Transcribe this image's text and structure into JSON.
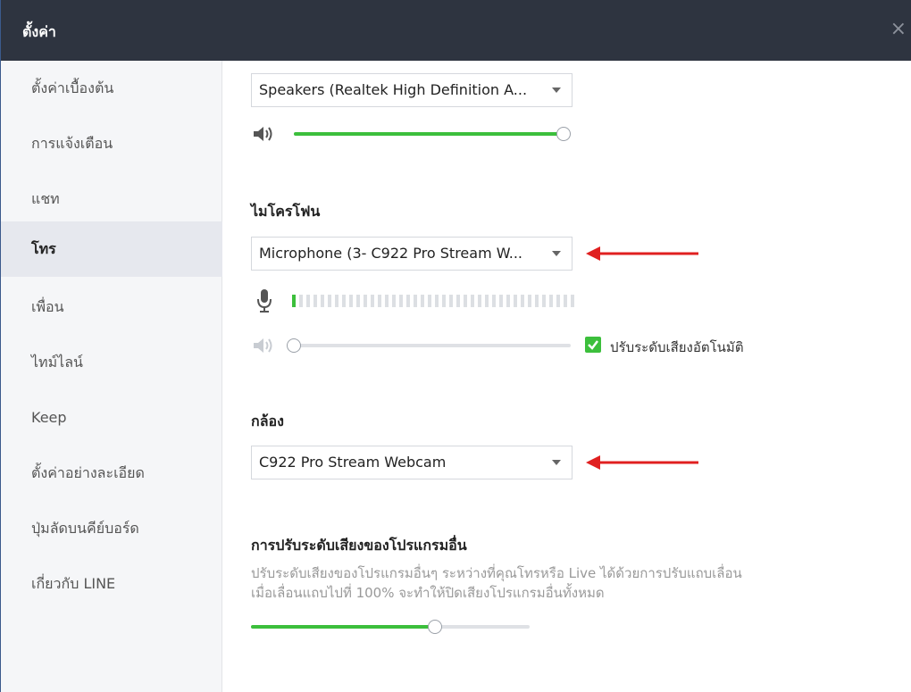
{
  "window": {
    "title": "ตั้งค่า",
    "close_glyph": "×"
  },
  "sidebar": {
    "items": [
      {
        "label": "ตั้งค่าเบื้องต้น"
      },
      {
        "label": "การแจ้งเตือน"
      },
      {
        "label": "แชท"
      },
      {
        "label": "โทร",
        "active": true
      },
      {
        "label": "เพื่อน"
      },
      {
        "label": "ไทม์ไลน์"
      },
      {
        "label": "Keep"
      },
      {
        "label": "ตั้งค่าอย่างละเอียด"
      },
      {
        "label": "ปุ่มลัดบนคีย์บอร์ด"
      },
      {
        "label": "เกี่ยวกับ LINE"
      }
    ]
  },
  "speaker": {
    "device": "Speakers (Realtek High Definition A...",
    "volume": 1.0
  },
  "microphone": {
    "heading": "ไมโครโฟน",
    "device": "Microphone (3- C922 Pro Stream W...",
    "input_level_segments_on": 1,
    "volume": 0.0,
    "auto_adjust_label": "ปรับระดับเสียงอัตโนมัติ",
    "auto_adjust_checked": true
  },
  "camera": {
    "heading": "กล้อง",
    "device": "C922 Pro Stream Webcam"
  },
  "other_apps": {
    "heading": "การปรับระดับเสียงของโปรแกรมอื่น",
    "desc_line1": "ปรับระดับเสียงของโปรแกรมอื่นๆ ระหว่างที่คุณโทรหรือ Live ได้ด้วยการปรับแถบเลื่อน",
    "desc_line2": "เมื่อเลื่อนแถบไปที่ 100% จะทำให้ปิดเสียงโปรแกรมอื่นทั้งหมด",
    "volume": 0.66
  },
  "colors": {
    "accent": "#3cbf3c",
    "arrow": "#e02020",
    "titlebar": "#2e3440"
  }
}
